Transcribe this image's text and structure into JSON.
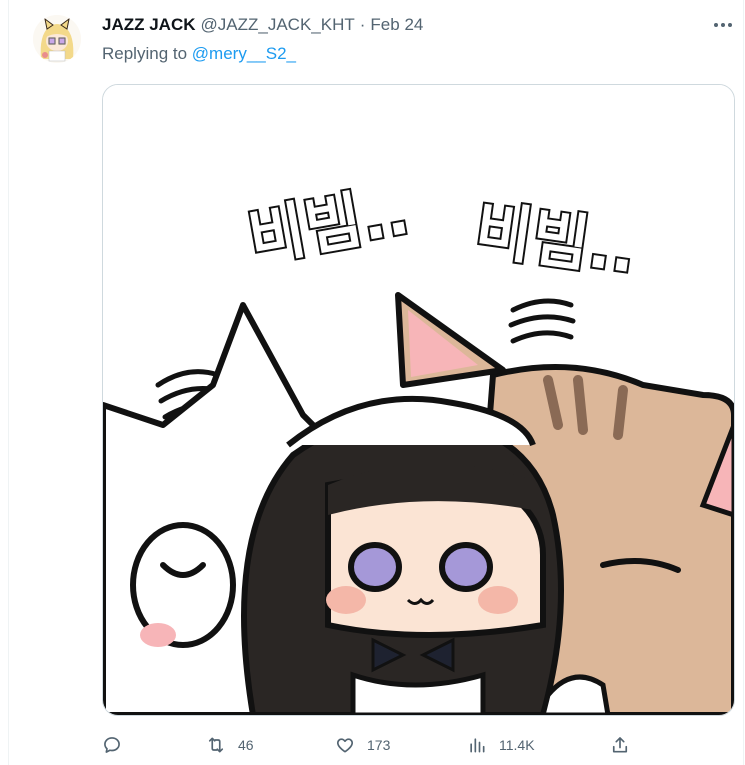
{
  "tweet": {
    "author_name": "JAZZ JACK",
    "author_handle": "@JAZZ_JACK_KHT",
    "separator": "·",
    "date": "Feb 24",
    "replying_prefix": "Replying to",
    "replying_to": "@mery__S2_",
    "media": {
      "sound_text_1": "비빔..",
      "sound_text_2": "비빔.."
    }
  },
  "actions": {
    "reply_count": "",
    "retweet_count": "46",
    "like_count": "173",
    "views_count": "11.4K"
  },
  "icons": {
    "more": "more-icon",
    "reply": "reply-icon",
    "retweet": "retweet-icon",
    "like": "heart-icon",
    "views": "views-icon",
    "share": "share-icon"
  },
  "colors": {
    "link": "#1d9bf0",
    "muted": "#536471",
    "text": "#0f1419",
    "border": "#cfd9de"
  }
}
